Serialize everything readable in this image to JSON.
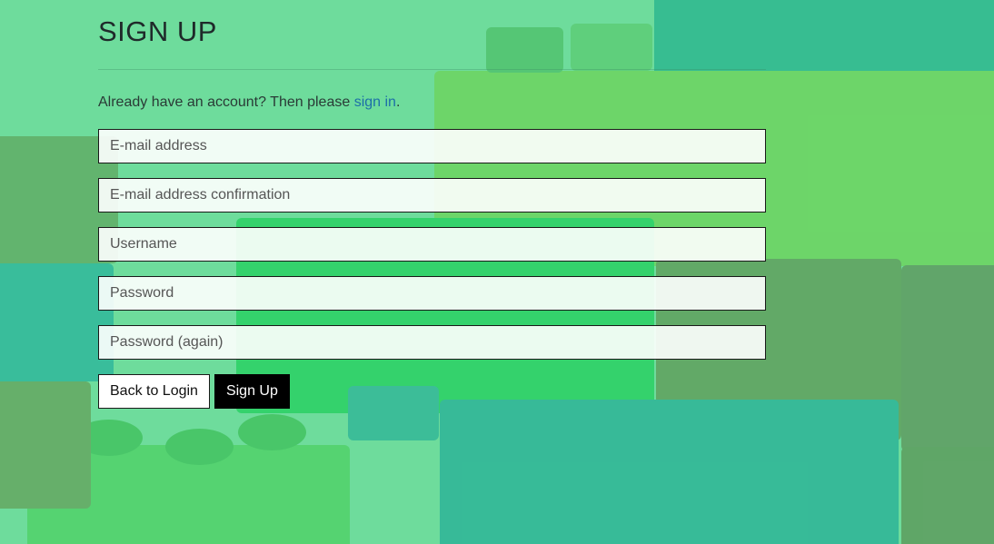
{
  "page": {
    "title": "SIGN UP"
  },
  "intro": {
    "text": "Already have an account? Then please ",
    "link_text": "sign in",
    "suffix": "."
  },
  "form": {
    "email_placeholder": "E-mail address",
    "email_confirm_placeholder": "E-mail address confirmation",
    "username_placeholder": "Username",
    "password_placeholder": "Password",
    "password_again_placeholder": "Password (again)"
  },
  "buttons": {
    "back_label": "Back to Login",
    "signup_label": "Sign Up"
  },
  "colors": {
    "background": "#6fdc9c",
    "link": "#1d6fa8",
    "primary_button": "#000000"
  }
}
